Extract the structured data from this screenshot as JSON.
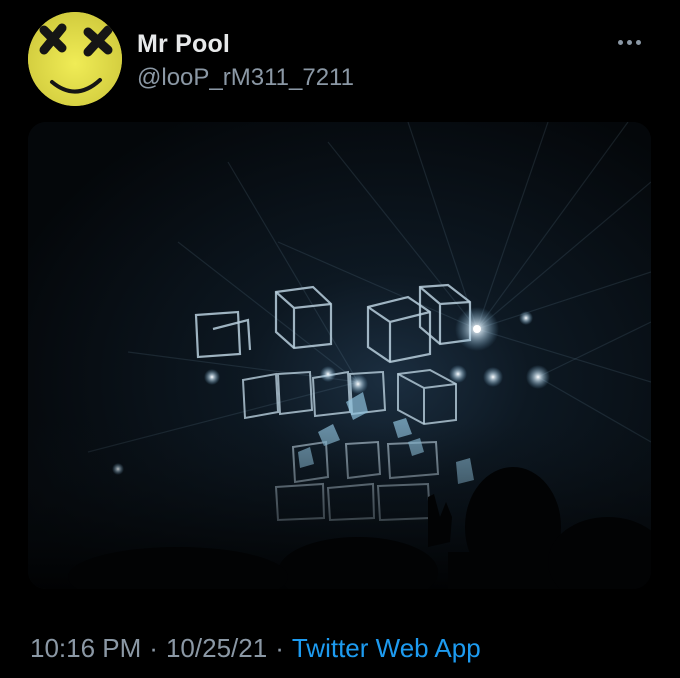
{
  "tweet": {
    "author": {
      "display_name": "Mr Pool",
      "handle": "@looP_rM311_7211",
      "avatar_icon": "yellow-face-x-eyes-icon"
    },
    "more_icon": "more-horizontal-icon",
    "media": {
      "kind": "photo"
    },
    "meta": {
      "time": "10:16 PM",
      "separator": "·",
      "date": "10/25/21",
      "source": "Twitter Web App"
    }
  },
  "colors": {
    "background": "#000000",
    "name_text": "#e7e9ea",
    "secondary_text": "#8b98a5",
    "link": "#1d9bf0",
    "avatar_yellow": "#e6e24a"
  }
}
